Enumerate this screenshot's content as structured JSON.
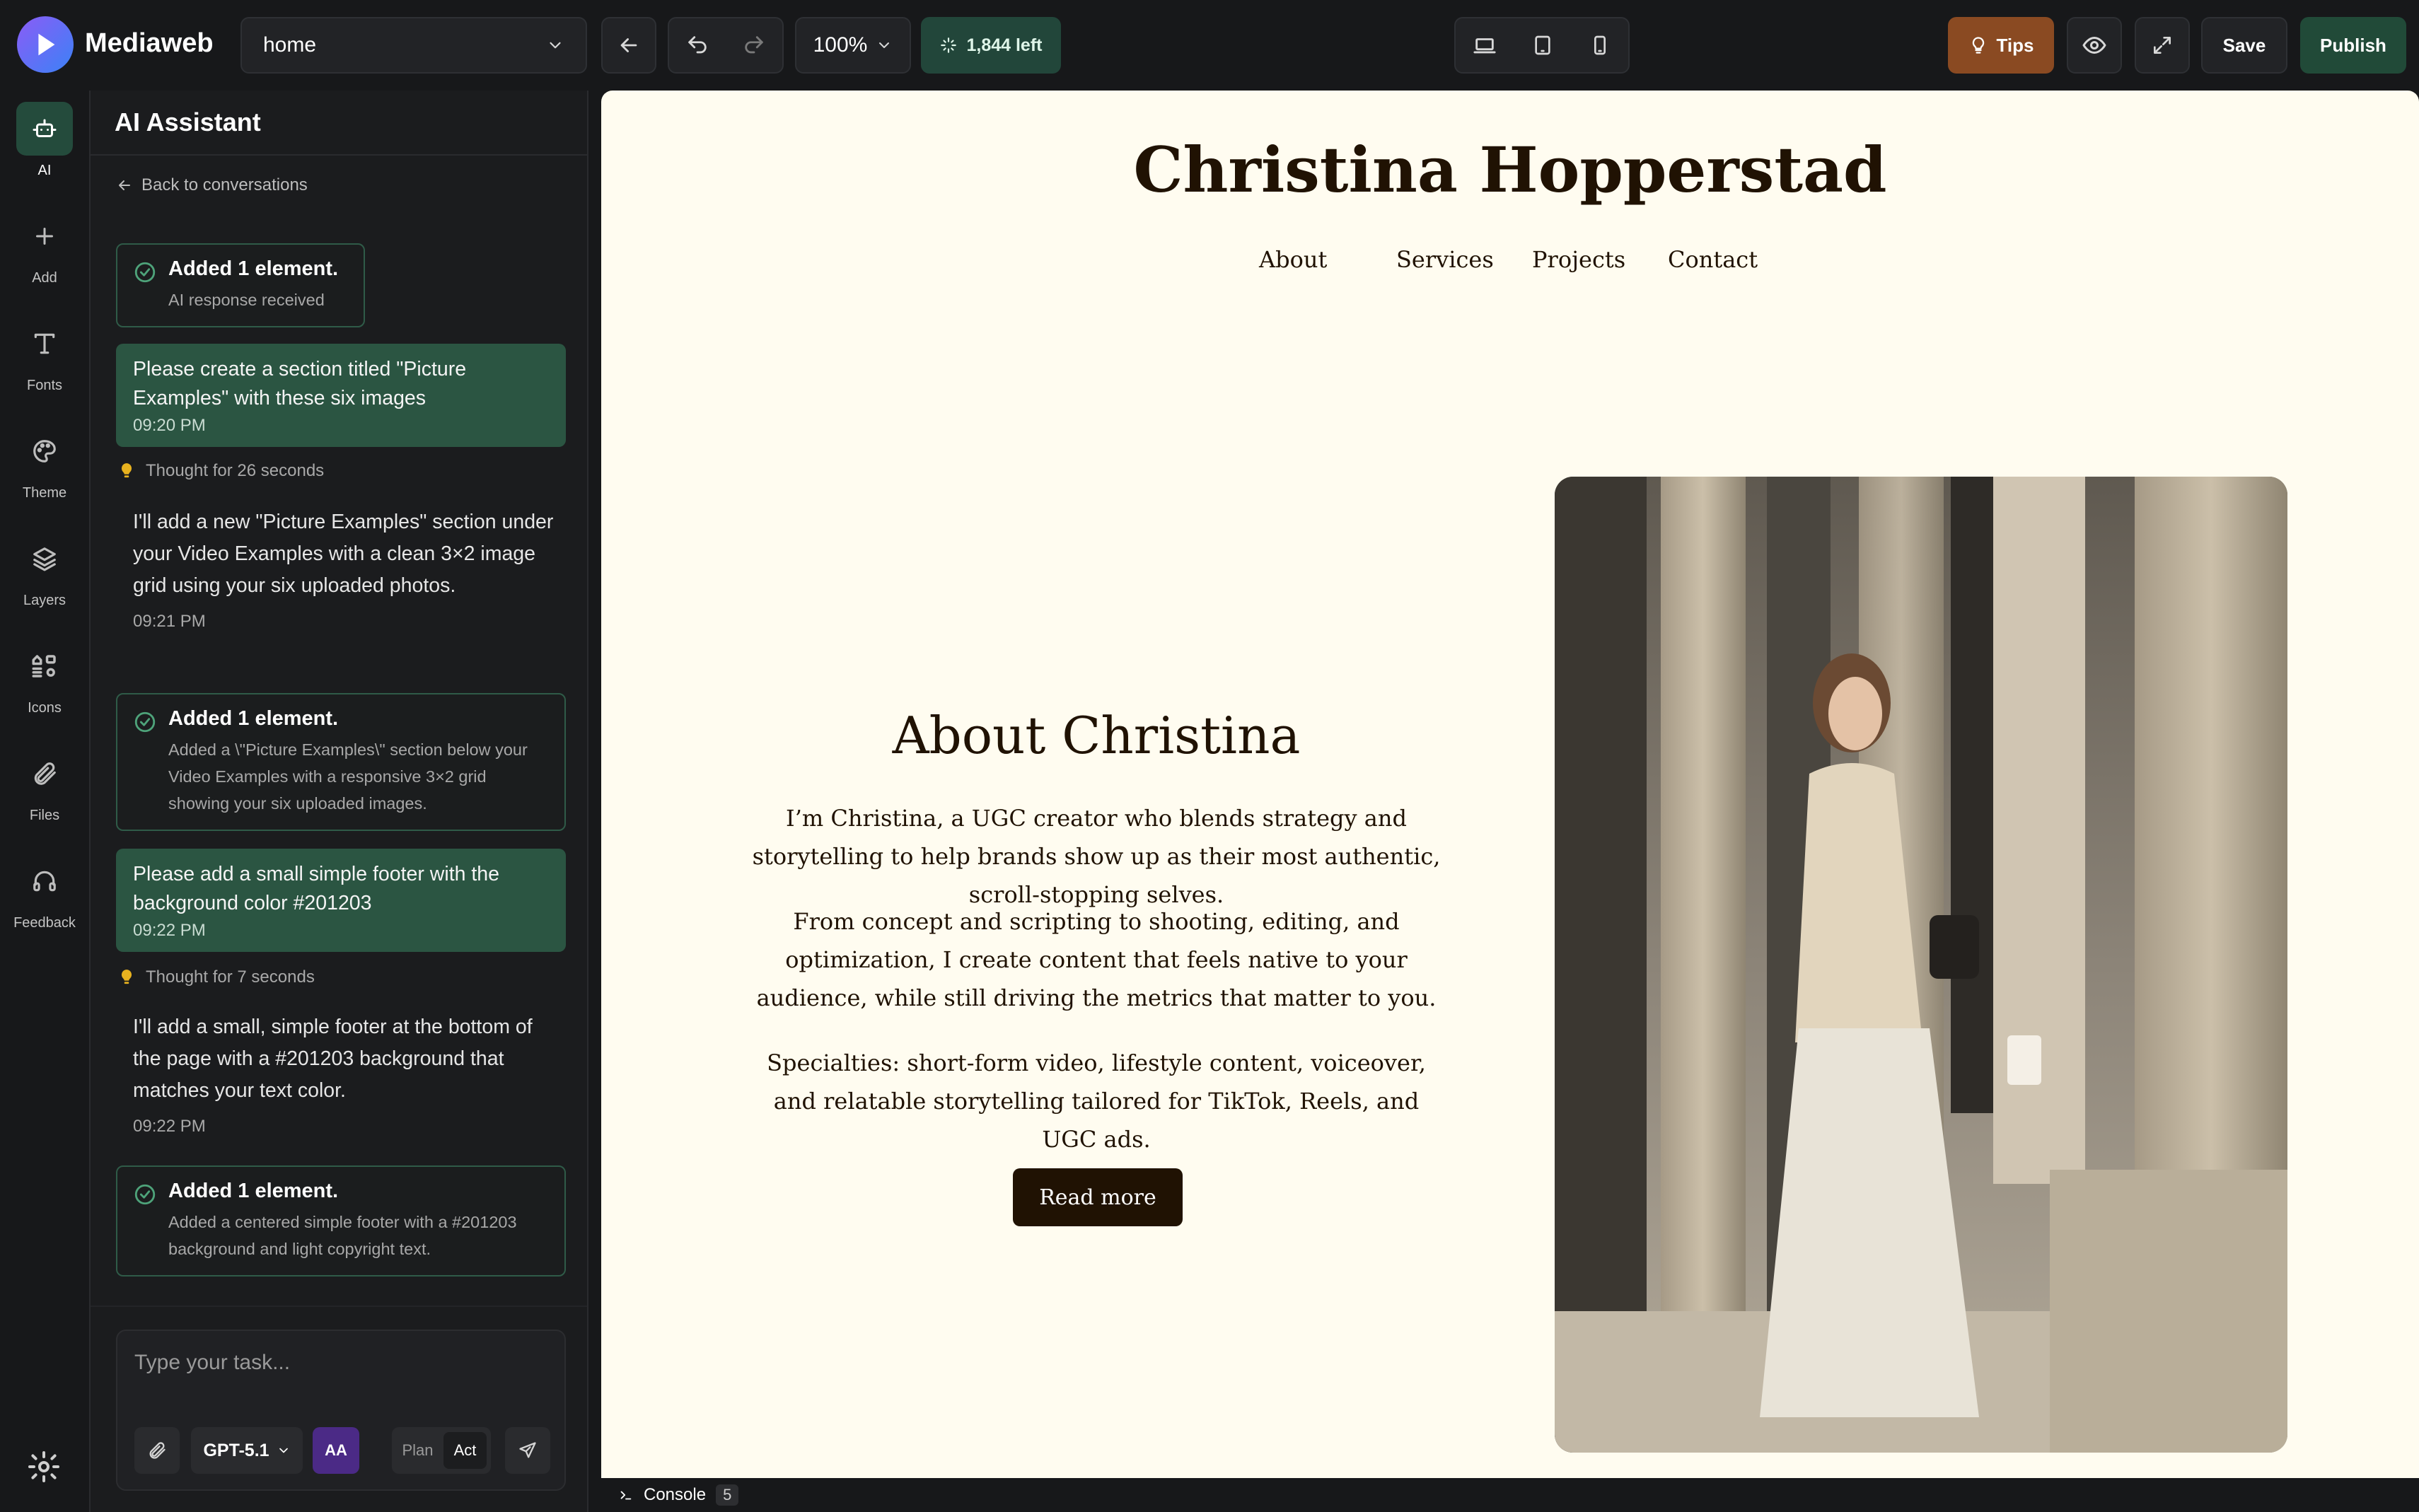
{
  "app": {
    "name": "Mediaweb"
  },
  "toolbar": {
    "page": "home",
    "zoom": "100%",
    "credits": "1,844 left",
    "tips": "Tips",
    "save": "Save",
    "publish": "Publish"
  },
  "rail": {
    "ai": "AI",
    "add": "Add",
    "fonts": "Fonts",
    "theme": "Theme",
    "layers": "Layers",
    "icons": "Icons",
    "files": "Files",
    "feedback": "Feedback"
  },
  "assistant": {
    "title": "AI Assistant",
    "back": "Back to conversations",
    "messages": [
      {
        "type": "card",
        "title": "Added 1 element.",
        "subtitle": "AI response received"
      },
      {
        "type": "user",
        "text": "Please create a section titled \"Picture Examples\" with these six images",
        "time": "09:20 PM"
      },
      {
        "type": "thought",
        "text": "Thought for 26 seconds"
      },
      {
        "type": "assistant",
        "text": "I'll add a new \"Picture Examples\" section under your Video Examples with a clean 3×2 image grid using your six uploaded photos.",
        "time": "09:21 PM"
      },
      {
        "type": "card",
        "title": "Added 1 element.",
        "subtitle": "Added a \\\"Picture Examples\\\" section below your Video Examples with a responsive 3×2 grid showing your six uploaded images."
      },
      {
        "type": "user",
        "text": "Please add a small simple footer with the background color #201203",
        "time": "09:22 PM"
      },
      {
        "type": "thought",
        "text": "Thought for 7 seconds"
      },
      {
        "type": "assistant",
        "text": "I'll add a small, simple footer at the bottom of the page with a #201203 background that matches your text color.",
        "time": "09:22 PM"
      },
      {
        "type": "card",
        "title": "Added 1 element.",
        "subtitle": "Added a centered simple footer with a #201203 background and light copyright text."
      }
    ],
    "composer": {
      "placeholder": "Type your task...",
      "model": "GPT-5.1",
      "aa": "AA",
      "plan": "Plan",
      "act": "Act"
    }
  },
  "site": {
    "title": "Christina Hopperstad",
    "nav": [
      "About",
      "Services",
      "Projects",
      "Contact"
    ],
    "about": {
      "heading": "About Christina",
      "p1": "I’m Christina, a UGC creator who blends strategy and storytelling to help brands show up as their most authentic, scroll-stopping selves.",
      "p2": "From concept and scripting to shooting, editing, and optimization, I create content that feels native to your audience, while still driving the metrics that matter to you.",
      "p3": "Specialties: short-form video, lifestyle content, voiceover, and relatable storytelling tailored for TikTok, Reels, and UGC ads.",
      "button": "Read more"
    }
  },
  "console": {
    "label": "Console",
    "count": "5"
  },
  "colors": {
    "brand_green": "#244b3c",
    "user_bubble": "#2b5542",
    "canvas_bg": "#fffcf0",
    "text_dark": "#201203",
    "tips": "#8a4a22"
  }
}
